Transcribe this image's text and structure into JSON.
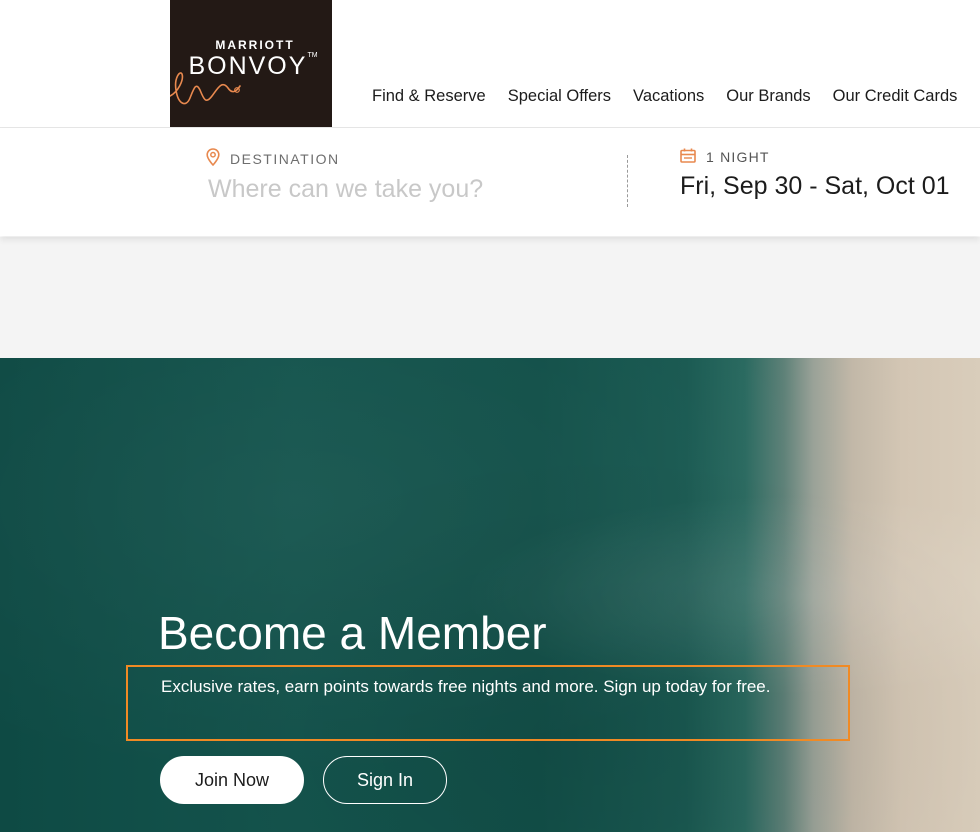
{
  "brand": {
    "logo_top": "MARRIOTT",
    "logo_main": "BONVOY",
    "logo_tm": "TM"
  },
  "nav": {
    "items": [
      {
        "label": "Find & Reserve"
      },
      {
        "label": "Special Offers"
      },
      {
        "label": "Vacations"
      },
      {
        "label": "Our Brands"
      },
      {
        "label": "Our Credit Cards"
      }
    ]
  },
  "search": {
    "destination_label": "DESTINATION",
    "destination_placeholder": "Where can we take you?",
    "destination_value": "",
    "nights_label": "1 NIGHT",
    "dates_value": "Fri, Sep 30 - Sat, Oct 01"
  },
  "hero": {
    "title": "Become a Member",
    "subtitle": "Exclusive rates, earn points towards free nights and more. Sign up today for free.",
    "join_label": "Join Now",
    "signin_label": "Sign In"
  },
  "colors": {
    "logo_bg": "#231915",
    "accent_orange": "#e8894f",
    "highlight_box": "#f08a24",
    "hero_teal": "#14544d",
    "sand": "#d3c6b4"
  },
  "icons": {
    "destination": "map-pin-icon",
    "dates": "calendar-icon"
  }
}
